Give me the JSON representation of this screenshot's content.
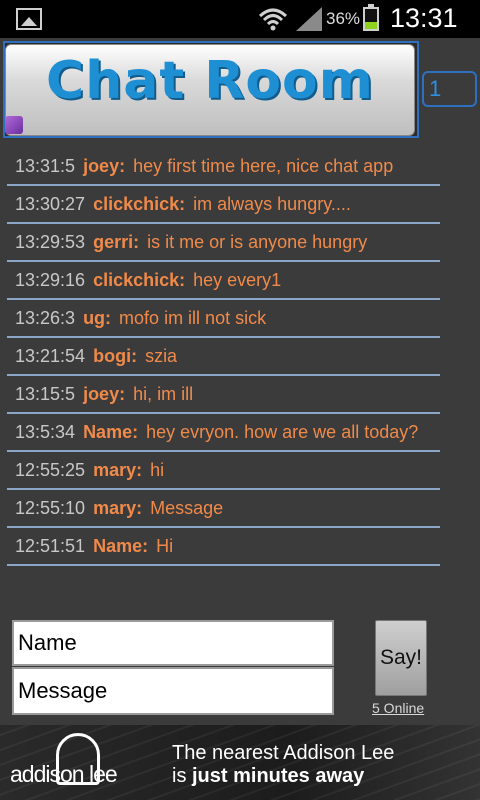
{
  "status_bar": {
    "battery_percent": "36%",
    "battery_level": 0.36,
    "time": "13:31",
    "icons": [
      "gallery-icon",
      "wifi-icon",
      "signal-icon",
      "battery-icon"
    ]
  },
  "header": {
    "title": "Chat Room",
    "room_count": "1"
  },
  "messages": [
    {
      "time": "13:31:5",
      "user": "joey:",
      "text": "hey first time here, nice chat app"
    },
    {
      "time": "13:30:27",
      "user": "clickchick:",
      "text": "im always hungry...."
    },
    {
      "time": "13:29:53",
      "user": "gerri:",
      "text": "is it me or is anyone hungry"
    },
    {
      "time": "13:29:16",
      "user": "clickchick:",
      "text": "hey every1"
    },
    {
      "time": "13:26:3",
      "user": "ug:",
      "text": "mofo im ill not sick"
    },
    {
      "time": "13:21:54",
      "user": " bogi:",
      "text": "szia"
    },
    {
      "time": "13:15:5",
      "user": "joey:",
      "text": "hi, im ill"
    },
    {
      "time": "13:5:34",
      "user": "Name:",
      "text": "hey evryon. how are we all today?"
    },
    {
      "time": "12:55:25",
      "user": "mary:",
      "text": "hi"
    },
    {
      "time": "12:55:10",
      "user": "mary:",
      "text": "Message"
    },
    {
      "time": "12:51:51",
      "user": "Name:",
      "text": "Hi"
    }
  ],
  "compose": {
    "name_value": "Name",
    "message_value": "Message",
    "say_label": "Say!",
    "online_label": "5 Online"
  },
  "ad": {
    "logo_text": "addison lee",
    "line1": "The nearest Addison Lee",
    "line2_prefix": "is ",
    "line2_bold": "just minutes away"
  },
  "colors": {
    "accent_blue": "#1f8fd4",
    "message_orange": "#f08a4a",
    "battery_green": "#8fd21e"
  }
}
